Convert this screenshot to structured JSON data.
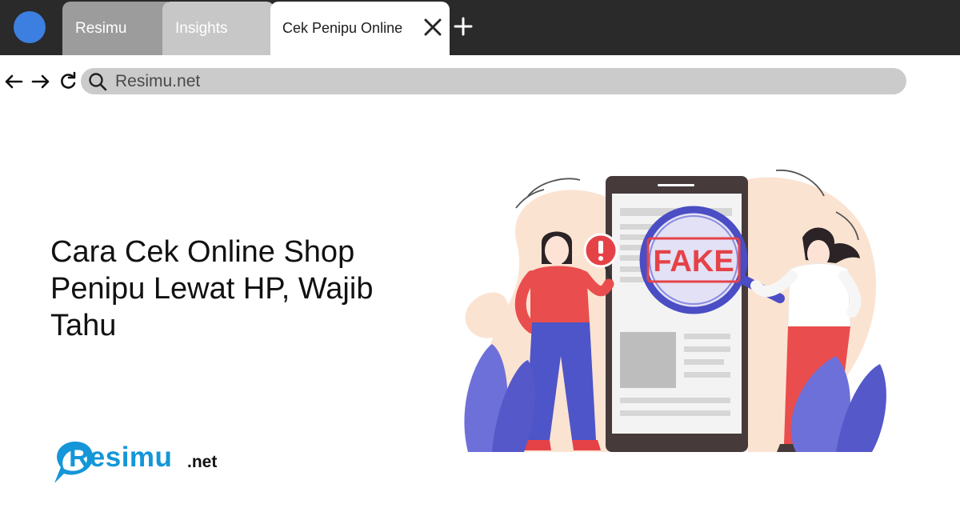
{
  "browser": {
    "tabs": [
      {
        "label": "Resimu",
        "active": false
      },
      {
        "label": "Insights",
        "active": false
      },
      {
        "label": "Cek Penipu Online",
        "active": true
      }
    ],
    "address_bar": {
      "url": "Resimu.net"
    },
    "icons": [
      "profile-icon",
      "close-icon",
      "plus-icon",
      "back-arrow-icon",
      "forward-arrow-icon",
      "reload-icon",
      "search-icon"
    ]
  },
  "page": {
    "headline": "Cara Cek Online Shop Penipu Lewat HP, Wajib Tahu",
    "illustration_text": "FAKE",
    "logo": {
      "name": "Resimu",
      "suffix": ".net"
    }
  },
  "colors": {
    "tabbar": "#2a2a2a",
    "profile": "#3d7fe0",
    "fake_red": "#e54248",
    "logo_blue": "#1496d8"
  }
}
